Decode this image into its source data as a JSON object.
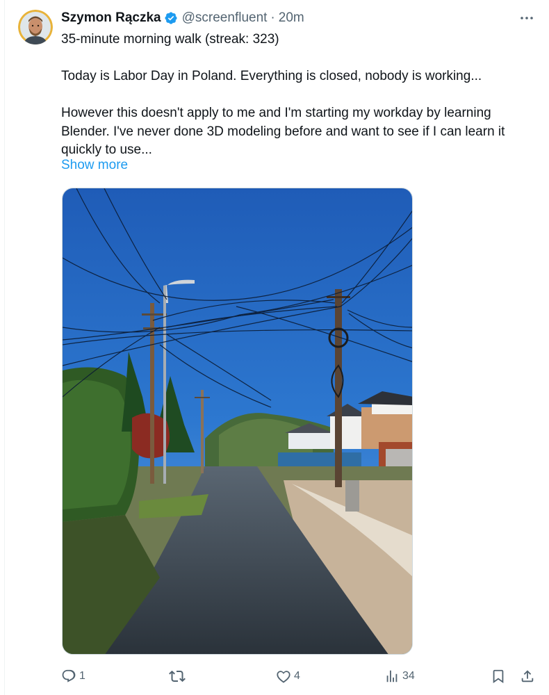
{
  "user": {
    "display_name": "Szymon Rączka",
    "handle": "@screenfluent",
    "separator": "·",
    "time": "20m",
    "avatar_icon": "avatar-photo",
    "verified_icon": "verified-badge-icon",
    "verified_color": "#1d9bf0"
  },
  "tweet": {
    "line1": "35-minute morning walk (streak: 323)",
    "line2": "Today is Labor Day in Poland. Everything is closed, nobody is working...",
    "line3": "However this doesn't apply to me and I'm starting my workday by learning Blender. I've never done 3D modeling before and want to see if I can learn it quickly to use...",
    "show_more": "Show more"
  },
  "media": {
    "icon": "photo-street-power-lines"
  },
  "actions": {
    "reply_count": "1",
    "retweet_count": "",
    "like_count": "4",
    "views_count": "34",
    "icons": [
      "reply-icon",
      "retweet-icon",
      "like-icon",
      "views-icon",
      "bookmark-icon",
      "share-icon"
    ]
  },
  "colors": {
    "link": "#1d9bf0",
    "secondary_text": "#536471",
    "primary_text": "#0f1419"
  }
}
